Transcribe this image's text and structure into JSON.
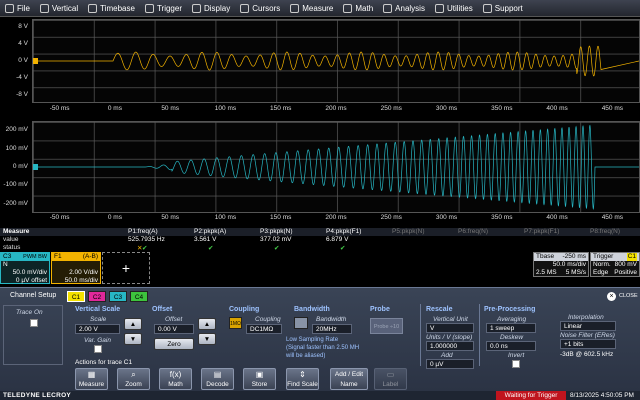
{
  "menu": [
    {
      "label": "File",
      "icon": "file-icon"
    },
    {
      "label": "Vertical",
      "icon": "vertical-icon"
    },
    {
      "label": "Timebase",
      "icon": "timebase-icon"
    },
    {
      "label": "Trigger",
      "icon": "trigger-icon"
    },
    {
      "label": "Display",
      "icon": "display-icon"
    },
    {
      "label": "Cursors",
      "icon": "cursors-icon"
    },
    {
      "label": "Measure",
      "icon": "measure-icon"
    },
    {
      "label": "Math",
      "icon": "math-icon"
    },
    {
      "label": "Analysis",
      "icon": "analysis-icon"
    },
    {
      "label": "Utilities",
      "icon": "utilities-icon"
    },
    {
      "label": "Support",
      "icon": "support-icon"
    }
  ],
  "grid1": {
    "y_labels": [
      "8 V",
      "4 V",
      "0 V",
      "-4 V",
      "-8 V"
    ],
    "x_labels": [
      "-50 ms",
      "0 ms",
      "50 ms",
      "100 ms",
      "150 ms",
      "200 ms",
      "250 ms",
      "300 ms",
      "350 ms",
      "400 ms",
      "450 ms"
    ],
    "color": "#f3b300"
  },
  "grid2": {
    "y_labels": [
      "200 mV",
      "100 mV",
      "0 mV",
      "-100 mV",
      "-200 mV"
    ],
    "x_labels": [
      "-50 ms",
      "0 ms",
      "50 ms",
      "100 ms",
      "150 ms",
      "200 ms",
      "250 ms",
      "300 ms",
      "350 ms",
      "400 ms",
      "450 ms"
    ],
    "color": "#27b7c4"
  },
  "measure": {
    "row_labels": [
      "Measure",
      "value",
      "status"
    ],
    "params": [
      {
        "name": "P1:freq(A)",
        "value": "525.7935 Hz",
        "status": "✔"
      },
      {
        "name": "P2:pkpk(A)",
        "value": "3.561 V",
        "status": "✔"
      },
      {
        "name": "P3:pkpk(N)",
        "value": "377.02 mV",
        "status": "✔"
      },
      {
        "name": "P4:pkpk(F1)",
        "value": "6.879 V",
        "status": "✔"
      },
      {
        "name": "P5:pkpk(N)",
        "value": "",
        "status": ""
      },
      {
        "name": "P6:freq(N)",
        "value": "",
        "status": ""
      },
      {
        "name": "P7:pkpk(F1)",
        "value": "",
        "status": ""
      },
      {
        "name": "P8:freq(N)",
        "value": "",
        "status": ""
      }
    ],
    "first_status": "✕"
  },
  "c3": {
    "label": "C3",
    "badges": "PWM BW",
    "sub": "N",
    "scale": "50.0 mV/div",
    "offset": "0 µV offset"
  },
  "f1": {
    "label": "F1",
    "formula": "(A-B)",
    "scale": "2.00 V/div",
    "time": "50.0 ms/div"
  },
  "add_plus": "+",
  "tbase": {
    "title": "Tbase",
    "value": "-250 ms",
    "div": "50.0 ms/div",
    "rate": "2.5 MS",
    "sr": "5 MS/s"
  },
  "trigger": {
    "title": "Trigger",
    "badge": "C1",
    "mode": "Norm.",
    "level": "800 mV",
    "type": "Edge",
    "slope": "Positive"
  },
  "dialog": {
    "title": "Channel Setup",
    "tabs": [
      {
        "label": "C1",
        "color": "#f3e100"
      },
      {
        "label": "C2",
        "color": "#e0289a"
      },
      {
        "label": "C3",
        "color": "#27b7c4"
      },
      {
        "label": "C4",
        "color": "#3dc43d"
      }
    ],
    "close": "CLOSE",
    "trace_on": "Trace On",
    "vertical_scale": {
      "header": "Vertical Scale",
      "scale_label": "Scale",
      "scale_value": "2.00 V",
      "var_gain": "Var. Gain"
    },
    "offset": {
      "header": "Offset",
      "label": "Offset",
      "value": "0.00 V",
      "zero": "Zero"
    },
    "coupling": {
      "header": "Coupling",
      "label": "Coupling",
      "value": "DC1MΩ",
      "badge": "1MΩ"
    },
    "bandwidth": {
      "header": "Bandwidth",
      "label": "Bandwidth",
      "value": "20MHz",
      "warning": "Low Sampling Rate\n(Signal faster than 2.50 MH\nwill be aliased)"
    },
    "probe": {
      "header": "Probe",
      "button": "Probe ÷10"
    },
    "rescale": {
      "header": "Rescale",
      "unit_label": "Vertical Unit",
      "unit_value": "V",
      "units_label": "Units / V (slope)",
      "units_value": "1.000000",
      "add_label": "Add",
      "add_value": "0 µV"
    },
    "preproc": {
      "header": "Pre-Processing",
      "avg_label": "Averaging",
      "avg_value": "1 sweep",
      "deskew_label": "Deskew",
      "deskew_value": "0.0 ns",
      "invert_label": "Invert"
    },
    "interp": {
      "label": "Interpolation",
      "value": "Linear",
      "noise_label": "Noise Filter (ERes)",
      "noise_value": "+1 bits",
      "noise_note": "-3dB @ 602.5 kHz"
    },
    "actions_label": "Actions for trace C1",
    "actions": [
      {
        "label": "Measure",
        "glyph": "▦",
        "icon": "measure-action-icon"
      },
      {
        "label": "Zoom",
        "glyph": "⌕",
        "icon": "zoom-action-icon"
      },
      {
        "label": "Math",
        "glyph": "f(x)",
        "icon": "math-action-icon"
      },
      {
        "label": "Decode",
        "glyph": "▤",
        "icon": "decode-action-icon"
      },
      {
        "label": "Store",
        "glyph": "▣",
        "icon": "store-action-icon"
      },
      {
        "label": "Find Scale",
        "glyph": "⇕",
        "icon": "find-scale-icon"
      },
      {
        "label": "Add / Edit Name",
        "glyph": "",
        "icon": ""
      },
      {
        "label": "Label",
        "glyph": "▭",
        "icon": "label-action-icon"
      }
    ]
  },
  "status": {
    "brand": "TELEDYNE LECROY",
    "trigger_state": "Waiting for Trigger",
    "datetime": "8/13/2025 4:50:05 PM",
    "colors": {
      "trigger_state": "#c0141e"
    }
  }
}
